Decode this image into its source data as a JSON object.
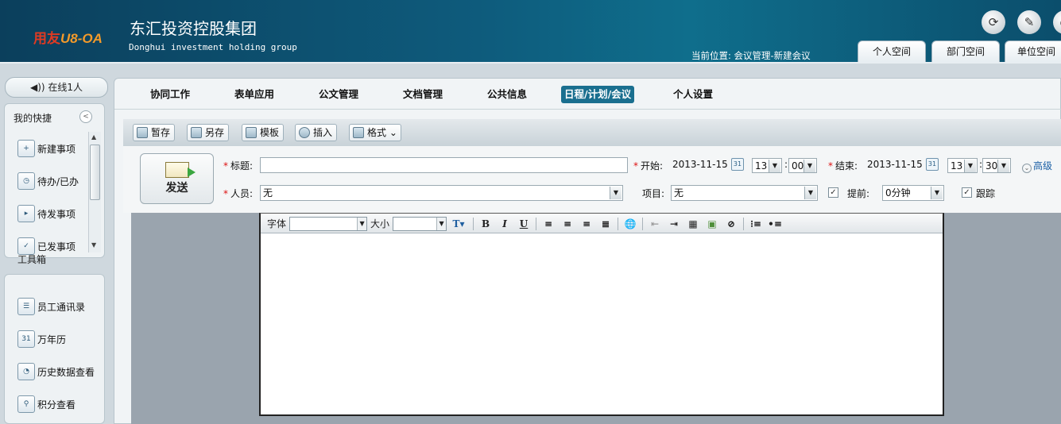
{
  "header": {
    "logo": {
      "brand": "用友",
      "product": "U8-OA"
    },
    "company_cn": "东汇投资控股集团",
    "company_en": "Donghui investment holding group",
    "location": "当前位置: 会议管理-新建会议",
    "icons": [
      "refresh-icon",
      "tools-icon",
      "user-icon"
    ],
    "space_tabs": [
      "个人空间",
      "部门空间",
      "单位空间"
    ]
  },
  "sidebar": {
    "online": "在线1人",
    "quick_title": "我的快捷",
    "quick_items": [
      "新建事项",
      "待办/已办",
      "待发事项",
      "已发事项"
    ],
    "tools_title": "工具箱",
    "tool_items": [
      "员工通讯录",
      "万年历",
      "历史数据查看",
      "积分查看"
    ],
    "calendar_day": "31"
  },
  "nav": {
    "items": [
      "协同工作",
      "表单应用",
      "公文管理",
      "文档管理",
      "公共信息",
      "日程/计划/会议",
      "个人设置"
    ],
    "active_index": 5
  },
  "toolbar": {
    "buttons": [
      "暂存",
      "另存",
      "模板",
      "插入",
      "格式"
    ]
  },
  "form": {
    "send_label": "发送",
    "title_label": "标题:",
    "title_value": "",
    "start_label": "开始:",
    "start_date": "2013-11-15",
    "start_hour": "13",
    "start_minute": "00",
    "end_label": "结束:",
    "end_date": "2013-11-15",
    "end_hour": "13",
    "end_minute": "30",
    "time_sep": ":",
    "advanced": "高级",
    "people_label": "人员:",
    "people_value": "无",
    "project_label": "项目:",
    "project_value": "无",
    "remind_label": "提前:",
    "remind_value": "0分钟",
    "remind_checked": true,
    "track_label": "跟踪",
    "track_checked": true,
    "required_mark": "*"
  },
  "editor": {
    "font_label": "字体",
    "size_label": "大小",
    "font_value": "",
    "size_value": "",
    "bold": "B",
    "italic": "I",
    "underline": "U",
    "color_btn": "T"
  }
}
